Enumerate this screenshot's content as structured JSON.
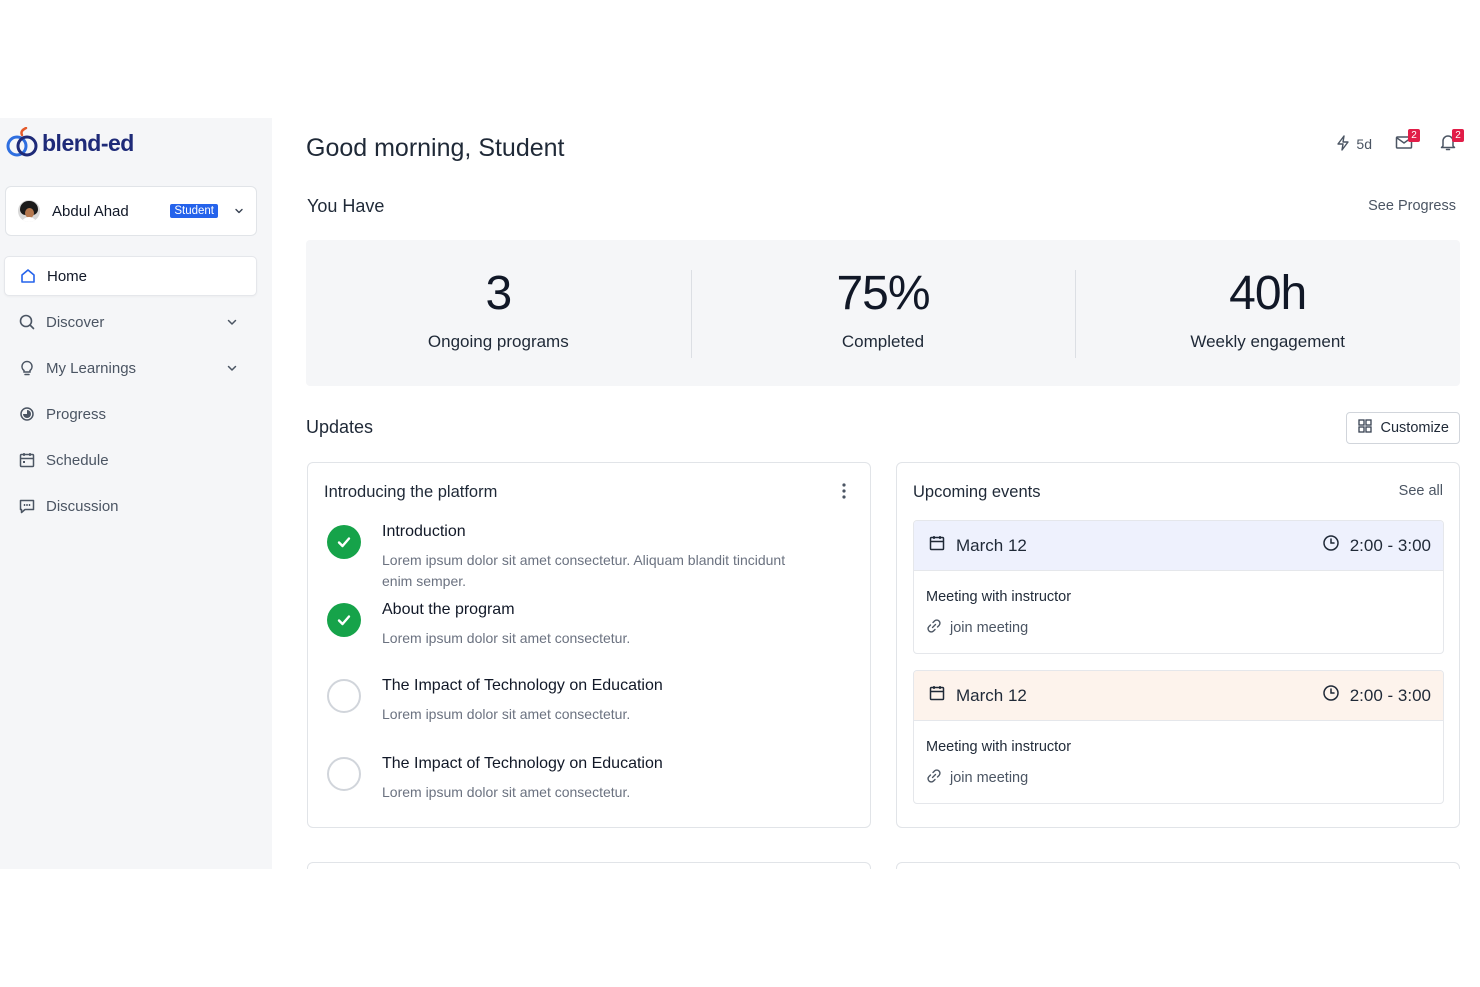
{
  "app": {
    "logo_text": "blend-ed"
  },
  "user": {
    "name": "Abdul Ahad",
    "role": "Student"
  },
  "nav": {
    "items": [
      {
        "label": "Home",
        "icon": "home-icon",
        "active": true
      },
      {
        "label": "Discover",
        "icon": "search-icon",
        "expandable": true
      },
      {
        "label": "My Learnings",
        "icon": "lightbulb-icon",
        "expandable": true
      },
      {
        "label": "Progress",
        "icon": "progress-icon"
      },
      {
        "label": "Schedule",
        "icon": "calendar-icon"
      },
      {
        "label": "Discussion",
        "icon": "chat-icon"
      }
    ]
  },
  "header": {
    "greeting": "Good morning, Student",
    "streak": "5d",
    "messages_count": "2",
    "notifications_count": "2"
  },
  "summary": {
    "title": "You Have",
    "see_progress": "See Progress",
    "stats": [
      {
        "value": "3",
        "label": "Ongoing programs"
      },
      {
        "value": "75%",
        "label": "Completed"
      },
      {
        "value": "40h",
        "label": "Weekly engagement"
      }
    ]
  },
  "updates": {
    "title": "Updates",
    "customize": "Customize",
    "platform_card": {
      "title": "Introducing the platform",
      "items": [
        {
          "title": "Introduction",
          "desc": "Lorem ipsum dolor sit amet consectetur. Aliquam blandit tincidunt enim semper.",
          "done": true
        },
        {
          "title": "About the program",
          "desc": "Lorem ipsum dolor sit amet consectetur.",
          "done": true
        },
        {
          "title": "The Impact of Technology on Education",
          "desc": "Lorem ipsum dolor sit amet consectetur.",
          "done": false
        },
        {
          "title": "The Impact of Technology on Education",
          "desc": "Lorem ipsum dolor sit amet consectetur.",
          "done": false
        }
      ]
    },
    "events_card": {
      "title": "Upcoming events",
      "see_all": "See all",
      "events": [
        {
          "date": "March 12",
          "time": "2:00 - 3:00",
          "title": "Meeting with instructor",
          "link": "join meeting",
          "color": "#eef1fd"
        },
        {
          "date": "March 12",
          "time": "2:00 - 3:00",
          "title": "Meeting with instructor",
          "link": "join meeting",
          "color": "#fdf3ec"
        }
      ]
    }
  },
  "colors": {
    "accent": "#2563eb",
    "success": "#16a34a",
    "badge": "#e11d48",
    "brand": "#1e2a78"
  }
}
